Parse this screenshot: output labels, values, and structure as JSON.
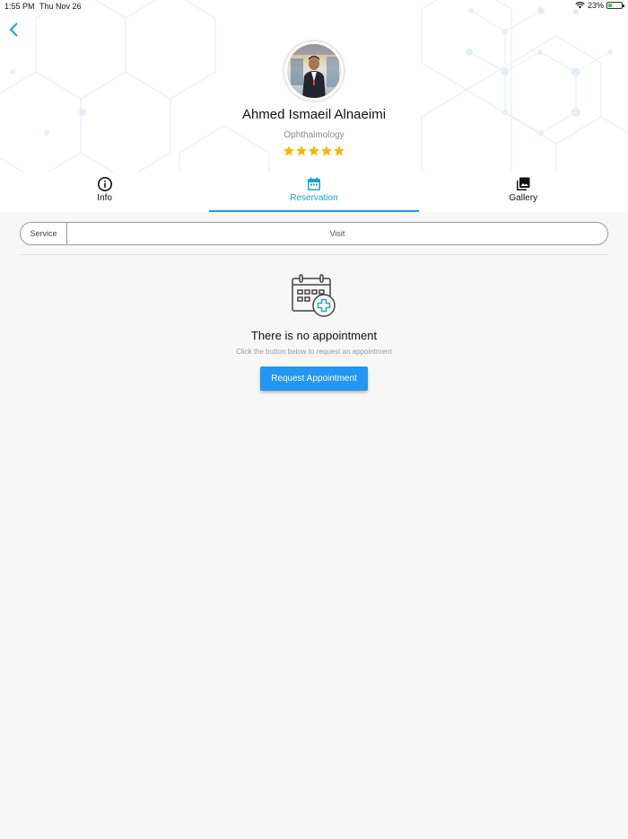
{
  "status_bar": {
    "time": "1:55 PM",
    "date": "Thu Nov 26",
    "battery": "23%",
    "battery_level": 0.23
  },
  "doctor": {
    "name": "Ahmed Ismaeil Alnaeimi",
    "specialty": "Ophthalmology",
    "rating": 5,
    "rating_max": 5
  },
  "tabs": [
    {
      "label": "Info",
      "icon": "info-icon",
      "active": false
    },
    {
      "label": "Reservation",
      "icon": "calendar-icon",
      "active": true
    },
    {
      "label": "Gallery",
      "icon": "gallery-icon",
      "active": false
    }
  ],
  "segment": {
    "service_label": "Service",
    "visit_label": "Visit"
  },
  "empty_state": {
    "icon": "calendar-add-icon",
    "title": "There is no appointment",
    "subtitle": "Click the button below to request an appointment",
    "button_label": "Request Appointment"
  },
  "colors": {
    "accent": "#1f9fd6",
    "button": "#2196f3",
    "star": "#f5b800"
  }
}
